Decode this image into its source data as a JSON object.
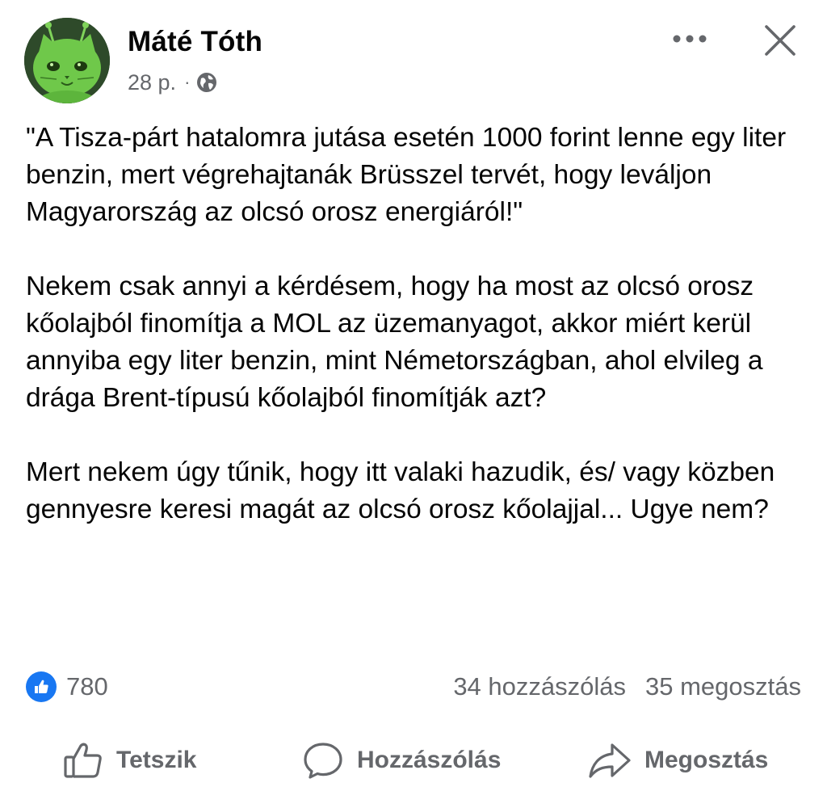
{
  "post": {
    "author": {
      "name": "Máté Tóth",
      "avatar_icon": "green-alien-cat-avatar"
    },
    "timestamp": "28 p.",
    "separator": "·",
    "audience_icon": "globe-icon",
    "paragraphs": [
      "\"A Tisza-párt hatalomra jutása esetén 1000 forint lenne egy liter benzin, mert végrehajtanák Brüsszel tervét, hogy leváljon Magyarország az olcsó orosz energiáról!\"",
      "Nekem csak annyi a kérdésem, hogy ha most az olcsó orosz kőolajból finomítja a MOL az üzemanyagot, akkor miért kerül annyiba egy liter benzin, mint Németországban, ahol elvileg a drága Brent-típusú kőolajból finomítják azt?",
      "Mert nekem úgy tűnik, hogy itt valaki hazudik, és/ vagy közben gennyesre keresi magát az olcsó orosz kőolajjal... Ugye nem?"
    ]
  },
  "stats": {
    "likes": "780",
    "comments": "34 hozzászólás",
    "shares": "35 megosztás"
  },
  "actions": {
    "like_label": "Tetszik",
    "comment_label": "Hozzászólás",
    "share_label": "Megosztás"
  },
  "colors": {
    "like_blue": "#1877f2",
    "secondary_text": "#65676b",
    "primary_text": "#050505",
    "avatar_green": "#6fc84a"
  }
}
